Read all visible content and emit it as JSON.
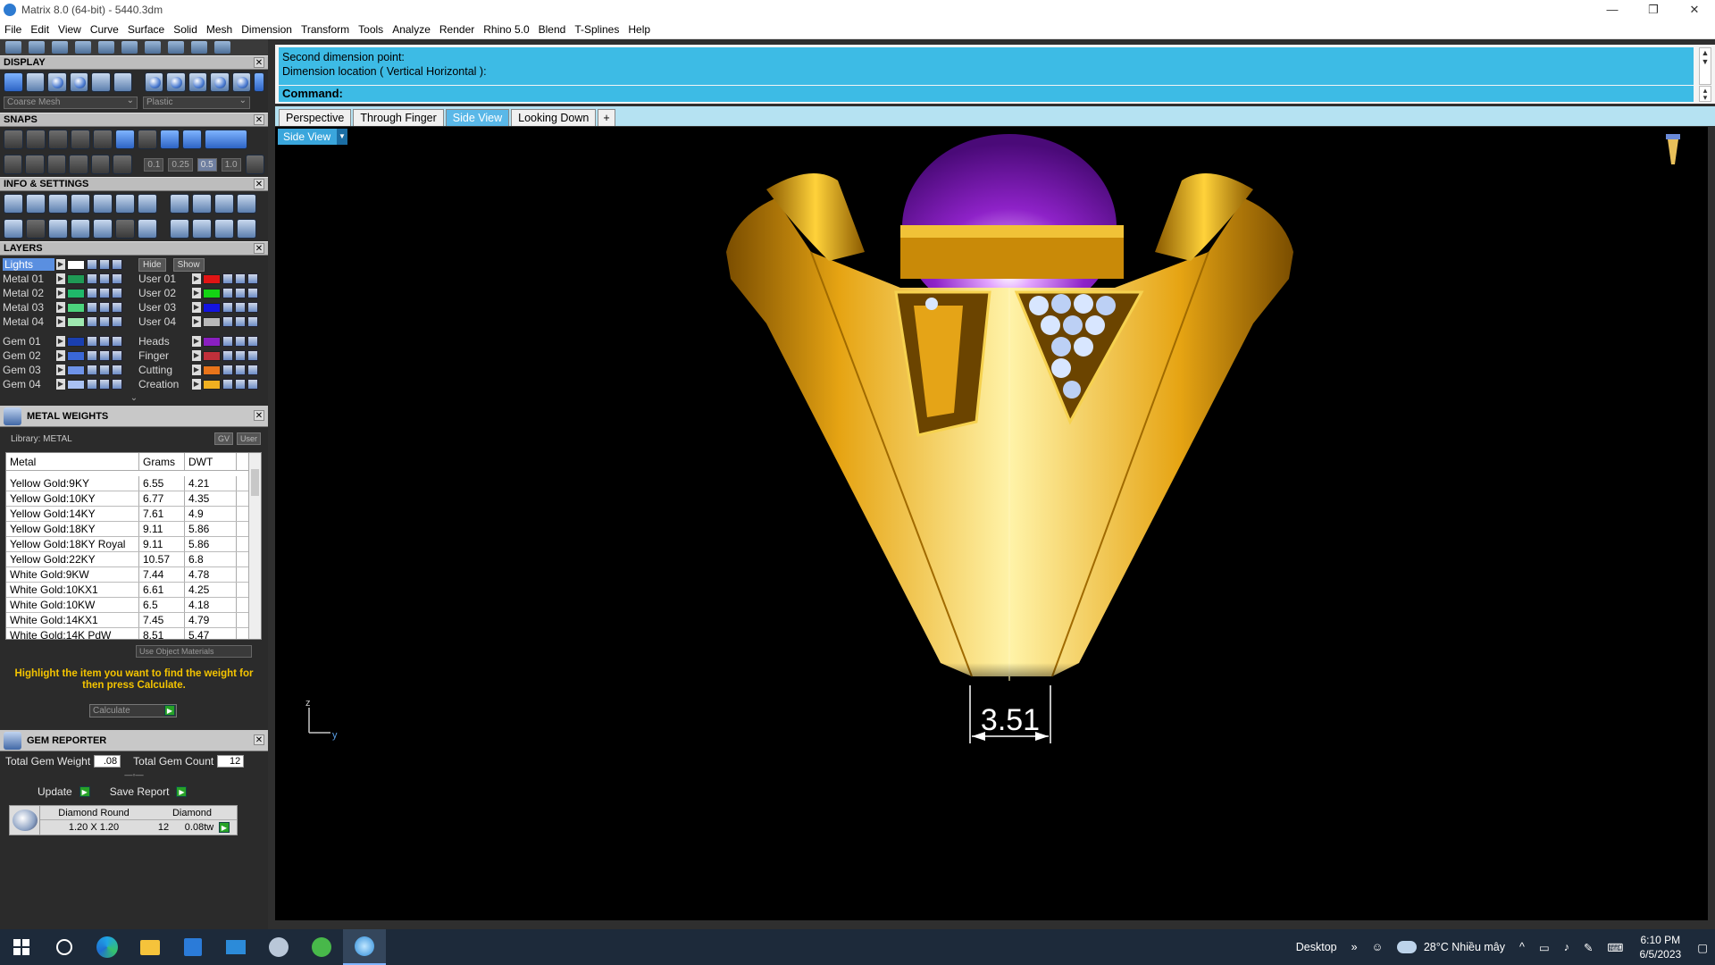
{
  "window": {
    "title": "Matrix 8.0 (64-bit) - 5440.3dm",
    "controls": [
      "—",
      "❐",
      "✕"
    ]
  },
  "menu": [
    "File",
    "Edit",
    "View",
    "Curve",
    "Surface",
    "Solid",
    "Mesh",
    "Dimension",
    "Transform",
    "Tools",
    "Analyze",
    "Render",
    "Rhino 5.0",
    "Blend",
    "T-Splines",
    "Help"
  ],
  "panels": {
    "display": {
      "title": "DISPLAY",
      "mesh_value": "Coarse Mesh",
      "material_value": "Plastic"
    },
    "snaps": {
      "title": "SNAPS",
      "values": [
        "0.1",
        "0.25",
        "0.5",
        "1.0"
      ],
      "active_value": "0.5"
    },
    "info": {
      "title": "INFO & SETTINGS"
    },
    "layers": {
      "title": "LAYERS",
      "hide_label": "Hide",
      "show_label": "Show",
      "left": [
        {
          "name": "Lights",
          "color": "#ffffff"
        },
        {
          "name": "Metal 01",
          "color": "#1f9a55"
        },
        {
          "name": "Metal 02",
          "color": "#1fb86a"
        },
        {
          "name": "Metal 03",
          "color": "#4cd47d"
        },
        {
          "name": "Metal 04",
          "color": "#9ee8b0"
        },
        {
          "name": "Gem 01",
          "color": "#1a3fb0"
        },
        {
          "name": "Gem 02",
          "color": "#3a67d6"
        },
        {
          "name": "Gem 03",
          "color": "#6e93e8"
        },
        {
          "name": "Gem 04",
          "color": "#a9c1f2"
        }
      ],
      "right": [
        {
          "name": "User 01",
          "color": "#e01414"
        },
        {
          "name": "User 02",
          "color": "#14d414"
        },
        {
          "name": "User 03",
          "color": "#1414e0"
        },
        {
          "name": "User 04",
          "color": "#b8b8b8"
        },
        {
          "name": "Heads",
          "color": "#8a1fc0"
        },
        {
          "name": "Finger",
          "color": "#c0303a"
        },
        {
          "name": "Cutting",
          "color": "#e8741a"
        },
        {
          "name": "Creation",
          "color": "#f0b020"
        }
      ]
    },
    "metal_weights": {
      "title": "METAL WEIGHTS",
      "library_label": "Library: METAL",
      "gv_label": "GV",
      "user_label": "User",
      "columns": [
        "Metal",
        "Grams",
        "DWT"
      ],
      "rows": [
        [
          "Yellow Gold:9KY",
          "6.55",
          "4.21"
        ],
        [
          "Yellow Gold:10KY",
          "6.77",
          "4.35"
        ],
        [
          "Yellow Gold:14KY",
          "7.61",
          "4.9"
        ],
        [
          "Yellow Gold:18KY",
          "9.11",
          "5.86"
        ],
        [
          "Yellow Gold:18KY Royal",
          "9.11",
          "5.86"
        ],
        [
          "Yellow Gold:22KY",
          "10.57",
          "6.8"
        ],
        [
          "White Gold:9KW",
          "7.44",
          "4.78"
        ],
        [
          "White Gold:10KX1",
          "6.61",
          "4.25"
        ],
        [
          "White Gold:10KW",
          "6.5",
          "4.18"
        ],
        [
          "White Gold:14KX1",
          "7.45",
          "4.79"
        ],
        [
          "White Gold:14K PdW",
          "8.51",
          "5.47"
        ]
      ],
      "use_object_materials": "Use Object Materials",
      "hint": "Highlight the item you want to find the weight for then press Calculate.",
      "calculate_label": "Calculate"
    },
    "gem_reporter": {
      "title": "GEM REPORTER",
      "total_weight_label": "Total Gem Weight",
      "total_weight_value": ".08",
      "total_count_label": "Total Gem Count",
      "total_count_value": "12",
      "update_label": "Update",
      "save_report_label": "Save Report",
      "gem": {
        "cut": "Diamond Round",
        "size": "1.20 X 1.20",
        "material": "Diamond",
        "count": "12",
        "weight": "0.08tw"
      }
    }
  },
  "command": {
    "history_line1": "Second dimension point:",
    "history_line2": "Dimension location ( Vertical  Horizontal ):",
    "prompt": "Command:"
  },
  "viewport": {
    "tabs": [
      "Perspective",
      "Through Finger",
      "Side View",
      "Looking Down",
      "+"
    ],
    "active_tab": "Side View",
    "selector_label": "Side View",
    "dimension_value": "3.51",
    "axis_z": "z",
    "axis_y": "y"
  },
  "taskbar": {
    "desktop_label": "Desktop",
    "weather_temp": "28°C",
    "weather_text": "Nhiều mây",
    "time": "6:10 PM",
    "date": "6/5/2023"
  }
}
